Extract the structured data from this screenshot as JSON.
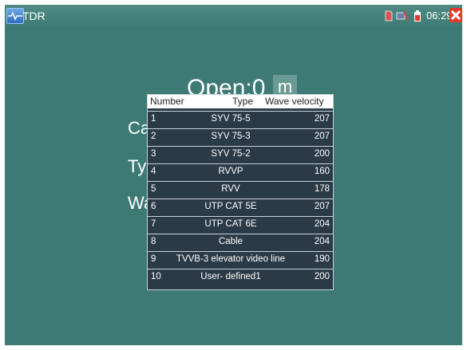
{
  "app": {
    "title": "TDR"
  },
  "status": {
    "time": "06:29"
  },
  "background": {
    "open_label": "Open:0",
    "unit": "m",
    "cable_label_partial": "Cal",
    "type_label_partial": "Typ",
    "wave_label_partial": "Wa"
  },
  "table": {
    "headers": {
      "number": "Number",
      "type": "Type",
      "velocity": "Wave velocity"
    },
    "rows": [
      {
        "num": "1",
        "type": "SYV 75-5",
        "velocity": "207"
      },
      {
        "num": "2",
        "type": "SYV 75-3",
        "velocity": "207"
      },
      {
        "num": "3",
        "type": "SYV 75-2",
        "velocity": "200"
      },
      {
        "num": "4",
        "type": "RVVP",
        "velocity": "160"
      },
      {
        "num": "5",
        "type": "RVV",
        "velocity": "178"
      },
      {
        "num": "6",
        "type": "UTP CAT 5E",
        "velocity": "207"
      },
      {
        "num": "7",
        "type": "UTP CAT 6E",
        "velocity": "204"
      },
      {
        "num": "8",
        "type": "Cable",
        "velocity": "204"
      },
      {
        "num": "9",
        "type": "TVVB-3 elevator video line",
        "velocity": "190"
      },
      {
        "num": "10",
        "type": "User- defined1",
        "velocity": "200"
      }
    ]
  },
  "colors": {
    "screen_bg": "#3d7a74",
    "popup_bg": "#2b3a47",
    "close_button": "#e03a2a"
  },
  "icons": [
    "tdr-app-icon",
    "sd-card-icon",
    "network-icon",
    "battery-icon",
    "close-icon"
  ]
}
